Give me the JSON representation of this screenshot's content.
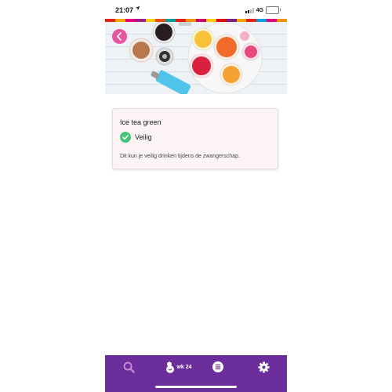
{
  "status_bar": {
    "time": "21:07",
    "network": "4G",
    "battery_level": 0.6,
    "icons": [
      "location-arrow-icon",
      "signal-icon",
      "battery-icon"
    ]
  },
  "stripe_colors": [
    "#e2231a",
    "#f7a600",
    "#e6007e",
    "#9b1f8a",
    "#ffd400",
    "#e94e1b",
    "#00a19a",
    "#e2231a",
    "#f39200",
    "#c8006e",
    "#ffcc00",
    "#e30613",
    "#7d2181",
    "#f7a600",
    "#e2231a",
    "#009fe3",
    "#e6007e",
    "#f39200"
  ],
  "header": {
    "back_icon": "chevron-left-icon",
    "accent": "#e8549e"
  },
  "item": {
    "title": "Ice tea green",
    "status_label": "Veilig",
    "status_icon": "check-circle-icon",
    "status_color": "#47c47a",
    "description": "Dit kun je veilig drinken tijdens de zwangerschap."
  },
  "nav": {
    "background": "#6b2e9a",
    "search_color": "#c98bd9",
    "week_label": "wk 24",
    "items": [
      "search-icon",
      "baby-icon",
      "list-icon",
      "gear-icon"
    ]
  }
}
